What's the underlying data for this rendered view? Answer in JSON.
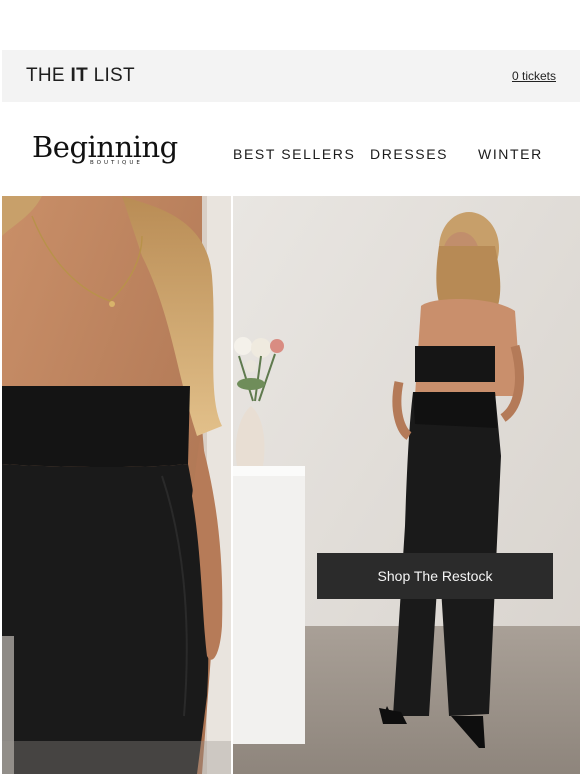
{
  "topbar": {
    "title_prefix": "THE",
    "title_bold": "IT",
    "title_suffix": "LIST",
    "tickets_link": "0 tickets"
  },
  "header": {
    "logo_word": "Beginning",
    "logo_sub": "BOUTIQUE",
    "nav": [
      "BEST SELLERS",
      "DRESSES",
      "WINTER"
    ]
  },
  "hero": {
    "left_image": "model-black-strapless-dress-closeup",
    "right_image": "model-black-backless-jumpsuit-studio",
    "cta_label": "Shop The Restock"
  },
  "colors": {
    "topbar_bg": "#f3f3f3",
    "cta_bg": "#2b2b2b",
    "cta_text": "#f5f5f5"
  }
}
